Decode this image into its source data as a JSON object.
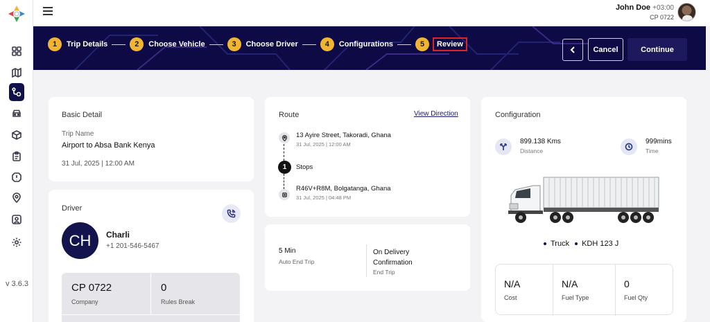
{
  "sidebar": {
    "version": "v 3.6.3",
    "icons": [
      "dashboard-icon",
      "map-icon",
      "trips-icon",
      "vehicle-icon",
      "box-icon",
      "clipboard-icon",
      "alert-icon",
      "location-icon",
      "user-icon",
      "settings-icon"
    ]
  },
  "topbar": {
    "user_name": "John Doe",
    "timezone": "+03:00",
    "user_code": "CP 0722"
  },
  "wizard": {
    "steps": [
      {
        "num": "1",
        "label": "Trip Details"
      },
      {
        "num": "2",
        "label": "Choose Vehicle"
      },
      {
        "num": "3",
        "label": "Choose Driver"
      },
      {
        "num": "4",
        "label": "Configurations"
      },
      {
        "num": "5",
        "label": "Review"
      }
    ],
    "current_step": 5,
    "cancel_label": "Cancel",
    "continue_label": "Continue"
  },
  "basic_detail": {
    "title": "Basic Detail",
    "trip_name_label": "Trip Name",
    "trip_name": "Airport to Absa Bank Kenya",
    "datetime": "31 Jul, 2025 | 12:00 AM"
  },
  "driver": {
    "title": "Driver",
    "initials": "CH",
    "name": "Charli",
    "phone": "+1 201-546-5467",
    "stats": [
      {
        "value": "CP 0722",
        "label": "Company"
      },
      {
        "value": "0",
        "label": "Rules Break"
      }
    ]
  },
  "route": {
    "title": "Route",
    "view_direction": "View Direction",
    "origin": {
      "address": "13 Ayire Street, Takoradi, Ghana",
      "time": "31 Jul, 2025 | 12:00 AM"
    },
    "stops_count": "1",
    "stops_label": "Stops",
    "destination": {
      "address": "R46V+R8M, Bolgatanga, Ghana",
      "time": "31 Jul, 2025 | 04:48 PM"
    }
  },
  "end_trip": {
    "auto_value": "5 Min",
    "auto_label": "Auto End Trip",
    "delivery_value": "On Delivery Confirmation",
    "delivery_label": "End Trip"
  },
  "configuration": {
    "title": "Configuration",
    "distance_value": "899.138 Kms",
    "distance_label": "Distance",
    "time_value": "999mins",
    "time_label": "Time",
    "vehicle_type": "Truck",
    "plate": "KDH 123 J",
    "costs": [
      {
        "value": "N/A",
        "label": "Cost"
      },
      {
        "value": "N/A",
        "label": "Fuel Type"
      },
      {
        "value": "0",
        "label": "Fuel Qty"
      }
    ]
  }
}
